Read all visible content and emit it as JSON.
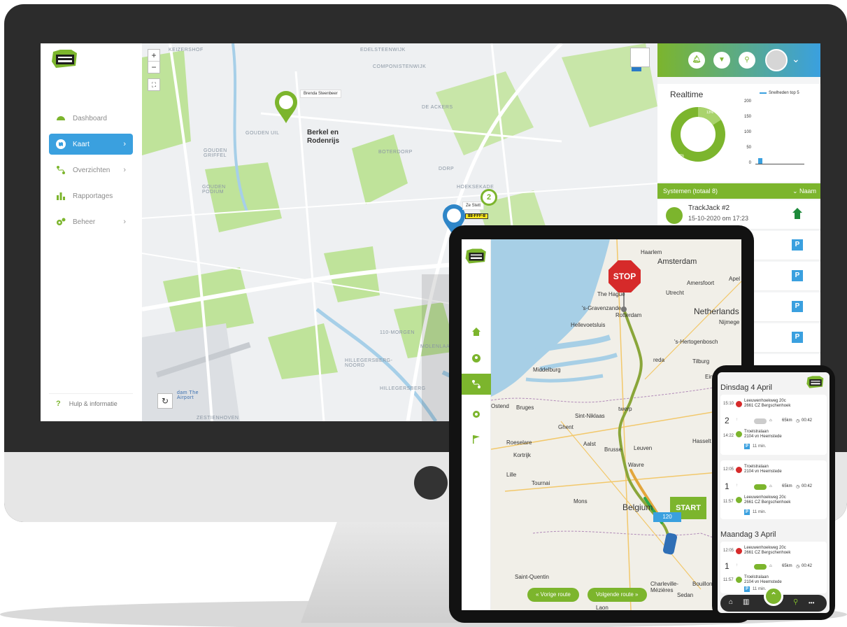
{
  "desktop": {
    "nav": [
      {
        "label": "Dashboard",
        "icon": "dashboard-icon",
        "has_chevron": false
      },
      {
        "label": "Kaart",
        "icon": "map-icon",
        "has_chevron": true,
        "active": true
      },
      {
        "label": "Overzichten",
        "icon": "route-icon",
        "has_chevron": true
      },
      {
        "label": "Rapportages",
        "icon": "bar-chart-icon",
        "has_chevron": false
      },
      {
        "label": "Beheer",
        "icon": "gear-icon",
        "has_chevron": true
      }
    ],
    "help_label": "Hulp & informatie",
    "map": {
      "zoom_in": "+",
      "zoom_out": "−",
      "labels": {
        "keizershof": "KEIZERSHOF",
        "edelsteenwijk": "EDELSTEENWIJK",
        "componistenwijk": "COMPONISTENWIJK",
        "de_ackers": "DE ACKERS",
        "gouden_uil": "GOUDEN UIL",
        "gouden_griffel": "GOUDEN GRIFFEL",
        "boterdorp": "BOTERDORP",
        "dorp": "DORP",
        "hoeksekade": "HOEKSEKADE",
        "gouden_podium": "GOUDEN PODIUM",
        "110_morgen": "110-MORGEN",
        "molenlaan": "MOLENLAAN",
        "hillegersberg_noord": "HILLEGERSBERG-NOORD",
        "hillegersberg": "HILLEGERSBERG",
        "zestienhoven": "ZESTIENHOVEN",
        "airport": "dam The\nAirport"
      },
      "city": "Berkel en\nRodenrijs",
      "marker_tag": "Brenda Steenbeer",
      "marker_tag2": "Ze Stett",
      "plate": "88-FFF-8",
      "cluster_count": "2"
    },
    "topbar_icons": [
      "bell-icon",
      "filter-icon",
      "search-icon"
    ],
    "realtime": {
      "title": "Realtime",
      "legend": "Snelheden top 5",
      "donut": {
        "main_pct": "88%",
        "minor_pct": "13%"
      },
      "y_ticks": [
        "200",
        "150",
        "100",
        "50",
        "0"
      ]
    },
    "systems_header": "Systemen (totaal 8)",
    "systems_sort": "Naam",
    "system": {
      "name": "TrackJack #2",
      "time": "15-10-2020 om 17:23"
    },
    "park_label": "P"
  },
  "tablet": {
    "map_labels": {
      "haarlem": "Haarlem",
      "amsterdam": "Amsterdam",
      "the_hague": "The Hague",
      "utrecht": "Utrecht",
      "amersfoort": "Amersfoort",
      "apel": "Apel",
      "gravenzande": "'s-Gravenzande",
      "rotterdam": "Rotterdam",
      "netherlands": "Netherlands",
      "hellevoetsluis": "Hellevoetsluis",
      "nijmegen": "Nijmege",
      "hertogenbosch": "'s-Hertogenbosch",
      "breda": "reda",
      "tilburg": "Tilburg",
      "middelburg": "Middelburg",
      "eindhoven": "Eindhov",
      "ostend": "Ostend",
      "bruges": "Bruges",
      "antwerp": "twerp",
      "sint_niklaas": "Sint-Niklaas",
      "ghent": "Ghent",
      "roeselare": "Roeselare",
      "aalst": "Aalst",
      "kortrijk": "Kortrijk",
      "brussels": "Brusse",
      "leuven": "Leuven",
      "hasselt": "Hasselt",
      "lille": "Lille",
      "tournai": "Tournai",
      "wavre": "Wavre",
      "mons": "Mons",
      "belgium": "Belgium",
      "saint_quentin": "Saint-Quentin",
      "charleville": "Charleville-\nMézières",
      "bouillon": "Bouillon",
      "sedan": "Sedan",
      "laon": "Laon"
    },
    "stop_label": "STOP",
    "start_label": "START",
    "speed_label": "120",
    "prev_route": "« Vorige route",
    "next_route": "Volgende route »"
  },
  "phone": {
    "days": [
      {
        "title": "Dinsdag 4 April",
        "trips": [
          {
            "start_time": "15:10",
            "start_addr": "Leeuwenhoekweg 20c\n2661 CZ Bergschenhoek",
            "count": "2",
            "km": "65km",
            "duration": "00:42",
            "end_time": "14:22",
            "end_addr": "Troelstralaan\n2104 vn Heemstede",
            "park": "11 min."
          },
          {
            "start_time": "12:05",
            "start_addr": "Troelstralaan\n2104 vn Heemstede",
            "count": "1",
            "km": "65km",
            "duration": "00:42",
            "end_time": "11:57",
            "end_addr": "Leeuwenhoekweg 20c\n2661 CZ Bergschenhoek",
            "park": "11 min."
          }
        ]
      },
      {
        "title": "Maandag 3 April",
        "trips": [
          {
            "start_time": "12:05",
            "start_addr": "Leeuwenhoekweg 20c\n2661 CZ Bergschenhoek",
            "count": "1",
            "km": "65km",
            "duration": "00:42",
            "end_time": "11:57",
            "end_addr": "Troelstralaan\n2104 vn Heemstede",
            "park": "11 min."
          }
        ]
      }
    ],
    "bottom_more": "•••"
  },
  "colors": {
    "green": "#7cb52d",
    "blue": "#3aa0df",
    "red": "#d62a2a"
  }
}
